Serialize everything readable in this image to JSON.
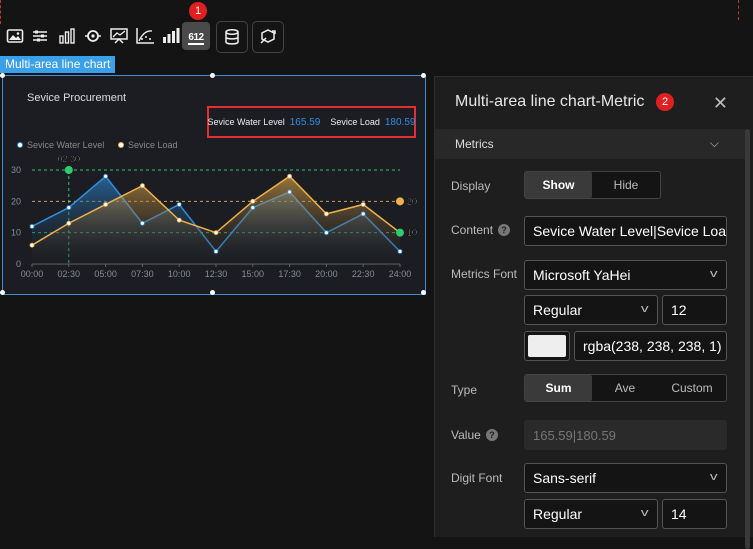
{
  "toolbar": {
    "icons": [
      "image-icon",
      "sliders-icon",
      "bar-chart-icon",
      "target-icon",
      "monitor-chart-icon",
      "scatter-curve-icon",
      "column-chart-icon",
      "digital-number-icon",
      "database-icon",
      "cube-link-icon"
    ],
    "digital_icon_text": "612",
    "badge_1": "1"
  },
  "widget": {
    "tag": "Multi-area line chart",
    "title": "Sevice Procurement",
    "metrics": [
      {
        "label": "Sevice Water Level",
        "value": "165.59"
      },
      {
        "label": "Sevice Load",
        "value": "180.59"
      }
    ]
  },
  "chart_data": {
    "type": "area",
    "categories": [
      "00:00",
      "02:30",
      "05:00",
      "07:30",
      "10:00",
      "12:30",
      "15:00",
      "17:30",
      "20:00",
      "22:30",
      "24:00"
    ],
    "series": [
      {
        "name": "Sevice Water Level",
        "color": "#2f8fe0",
        "values": [
          12,
          18,
          28,
          13,
          19,
          4,
          18,
          23,
          10,
          16,
          4
        ]
      },
      {
        "name": "Sevice Load",
        "color": "#f0b04a",
        "values": [
          6,
          13,
          19,
          25,
          14,
          10,
          20,
          28,
          16,
          19,
          10
        ]
      }
    ],
    "ylim": [
      0,
      30
    ],
    "yticks": [
      "0",
      "10",
      "20",
      "30"
    ],
    "markers": [
      {
        "label": "02:30",
        "x_index": 1,
        "value": 30,
        "color": "#2ecc71"
      },
      {
        "label": "20",
        "x_index": 10,
        "value": 20,
        "color": "#f0b04a"
      },
      {
        "label": "10",
        "x_index": 10,
        "value": 10,
        "color": "#2ecc71"
      }
    ],
    "grid": true,
    "legend": "top-left"
  },
  "panel": {
    "title": "Multi-area line chart-Metric",
    "badge_2": "2",
    "section": "Metrics",
    "display_label": "Display",
    "display_options": [
      "Show",
      "Hide"
    ],
    "display_selected": "Show",
    "content_label": "Content",
    "content_value": "Sevice Water Level|Sevice Load",
    "metrics_font_label": "Metrics Font",
    "metrics_font": "Microsoft YaHei",
    "metrics_weight": "Regular",
    "metrics_size": "12",
    "metrics_color": "rgba(238, 238, 238, 1)",
    "type_label": "Type",
    "type_options": [
      "Sum",
      "Ave",
      "Custom"
    ],
    "type_selected": "Sum",
    "value_label": "Value",
    "value_value": "165.59|180.59",
    "digit_font_label": "Digit Font",
    "digit_font": "Sans-serif",
    "digit_weight": "Regular",
    "digit_size": "14"
  }
}
